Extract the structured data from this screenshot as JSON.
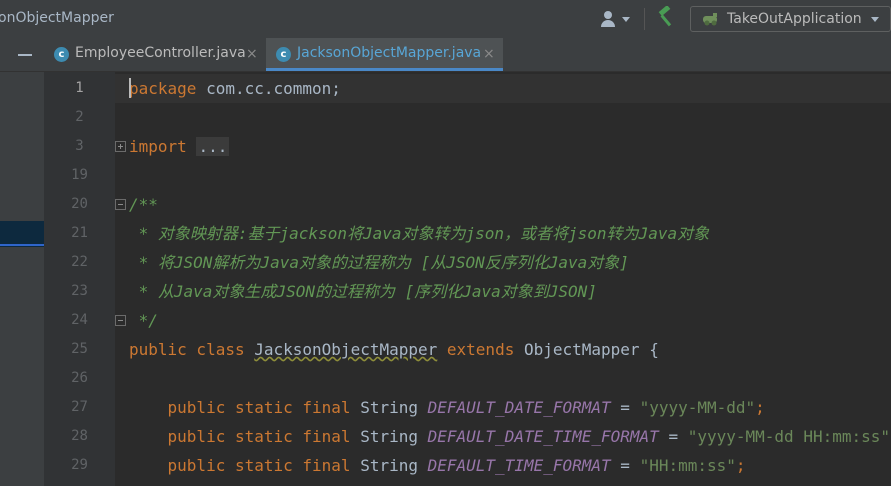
{
  "navbar": {
    "breadcrumb": "onObjectMapper"
  },
  "toolbar": {
    "run_config": "TakeOutApplication"
  },
  "tabs": [
    {
      "label": "EmployeeController.java",
      "close": "×"
    },
    {
      "label": "JacksonObjectMapper.java",
      "close": "×"
    }
  ],
  "gutter": {
    "line_numbers": [
      "1",
      "2",
      "3",
      "19",
      "20",
      "21",
      "22",
      "23",
      "24",
      "25",
      "26",
      "27",
      "28",
      "29"
    ]
  },
  "code": {
    "l1_kw": "package",
    "l1_rest": " com.cc.common;",
    "l3_kw": "import",
    "l3_fold": "...",
    "l20": "/**",
    "l21": " * 对象映射器:基于jackson将Java对象转为json，或者将json转为Java对象",
    "l22": " * 将JSON解析为Java对象的过程称为 [从JSON反序列化Java对象]",
    "l23": " * 从Java对象生成JSON的过程称为 [序列化Java对象到JSON]",
    "l24": " */",
    "l25_kw": "public class ",
    "l25_name": "JacksonObjectMapper",
    "l25_kw2": " extends ",
    "l25_rest": "ObjectMapper {",
    "field_modifiers": "public static final ",
    "field_type": "String ",
    "eq": " = ",
    "l27_name": "DEFAULT_DATE_FORMAT",
    "l27_value": "\"yyyy-MM-dd\"",
    "l27_end": ";",
    "l28_name": "DEFAULT_DATE_TIME_FORMAT",
    "l28_value": "\"yyyy-MM-dd HH:mm:ss\"",
    "l28_end": ";",
    "l29_name": "DEFAULT_TIME_FORMAT",
    "l29_value": "\"HH:mm:ss\"",
    "l29_end": ";"
  },
  "icons": {
    "user": "user-icon",
    "build": "hammer-icon",
    "run_config": "run-config-icon",
    "class_file": "java-class-icon",
    "tab_close": "close-icon"
  },
  "colors": {
    "background": "#2b2b2b",
    "keyword": "#cc7832",
    "doc_comment": "#629755",
    "string": "#6a8759",
    "constant": "#9876aa",
    "active_tab_text": "#58a6d6",
    "active_tab_underline": "#4a88c7"
  }
}
